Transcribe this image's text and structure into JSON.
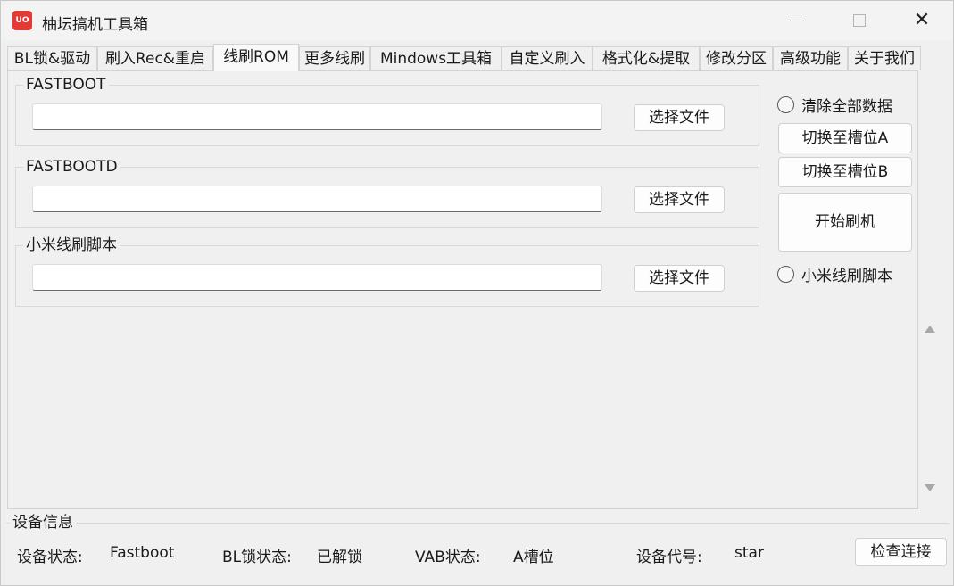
{
  "app": {
    "title": "柚坛搞机工具箱",
    "icon_text": "UO",
    "icon_color": "#e53935"
  },
  "window_controls": {
    "minimize_icon": "minimize-icon",
    "maximize_icon": "maximize-icon",
    "close_icon": "close-icon",
    "close_glyph": "✕"
  },
  "tabs": [
    {
      "label": "BL锁&驱动"
    },
    {
      "label": "刷入Rec&重启"
    },
    {
      "label": "线刷ROM",
      "active": true
    },
    {
      "label": "更多线刷"
    },
    {
      "label": "Mindows工具箱"
    },
    {
      "label": "自定义刷入"
    },
    {
      "label": "格式化&提取"
    },
    {
      "label": "修改分区"
    },
    {
      "label": "高级功能"
    },
    {
      "label": "关于我们"
    }
  ],
  "groups": [
    {
      "label": "FASTBOOT",
      "path_value": "",
      "button_label": "选择文件"
    },
    {
      "label": "FASTBOOTD",
      "path_value": "",
      "button_label": "选择文件"
    },
    {
      "label": "小米线刷脚本",
      "path_value": "",
      "button_label": "选择文件"
    }
  ],
  "side_panel": {
    "wipe_radio_label": "清除全部数据",
    "slot_a_button": "切换至槽位A",
    "slot_b_button": "切换至槽位B",
    "start_flash_button": "开始刷机",
    "mi_script_radio_label": "小米线刷脚本"
  },
  "device_info": {
    "title": "设备信息",
    "status_label": "设备状态:",
    "status_value": "Fastboot",
    "bl_label": "BL锁状态:",
    "bl_value": "已解锁",
    "vab_label": "VAB状态:",
    "vab_value": "A槽位",
    "codename_label": "设备代号:",
    "codename_value": "star",
    "check_button": "检查连接"
  }
}
